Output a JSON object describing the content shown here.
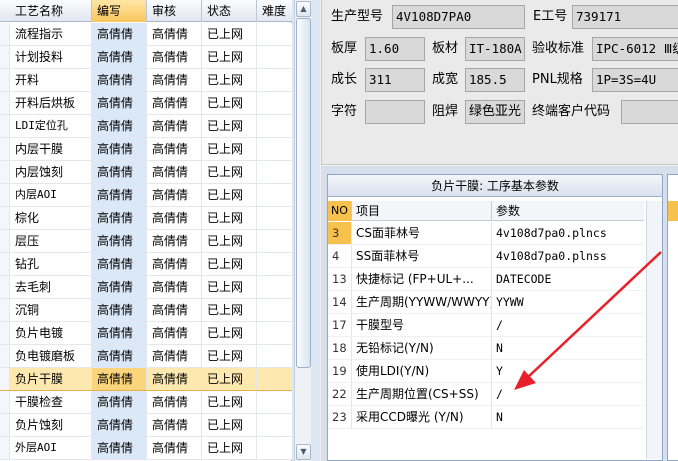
{
  "process_grid": {
    "headers": [
      "工艺名称",
      "编写",
      "审核",
      "状态",
      "难度"
    ],
    "active_header_index": 1,
    "selected_row_index": 16,
    "rows": [
      {
        "name": "流程指示",
        "writer": "高倩倩",
        "reviewer": "高倩倩",
        "status": "已上网",
        "difficulty": ""
      },
      {
        "name": "计划投料",
        "writer": "高倩倩",
        "reviewer": "高倩倩",
        "status": "已上网",
        "difficulty": ""
      },
      {
        "name": "开料",
        "writer": "高倩倩",
        "reviewer": "高倩倩",
        "status": "已上网",
        "difficulty": ""
      },
      {
        "name": "开料后烘板",
        "writer": "高倩倩",
        "reviewer": "高倩倩",
        "status": "已上网",
        "difficulty": ""
      },
      {
        "name": "LDI定位孔",
        "writer": "高倩倩",
        "reviewer": "高倩倩",
        "status": "已上网",
        "difficulty": ""
      },
      {
        "name": "内层干膜",
        "writer": "高倩倩",
        "reviewer": "高倩倩",
        "status": "已上网",
        "difficulty": ""
      },
      {
        "name": "内层蚀刻",
        "writer": "高倩倩",
        "reviewer": "高倩倩",
        "status": "已上网",
        "difficulty": ""
      },
      {
        "name": "内层AOI",
        "writer": "高倩倩",
        "reviewer": "高倩倩",
        "status": "已上网",
        "difficulty": ""
      },
      {
        "name": "棕化",
        "writer": "高倩倩",
        "reviewer": "高倩倩",
        "status": "已上网",
        "difficulty": ""
      },
      {
        "name": "层压",
        "writer": "高倩倩",
        "reviewer": "高倩倩",
        "status": "已上网",
        "difficulty": ""
      },
      {
        "name": "钻孔",
        "writer": "高倩倩",
        "reviewer": "高倩倩",
        "status": "已上网",
        "difficulty": ""
      },
      {
        "name": "去毛刺",
        "writer": "高倩倩",
        "reviewer": "高倩倩",
        "status": "已上网",
        "difficulty": ""
      },
      {
        "name": "沉铜",
        "writer": "高倩倩",
        "reviewer": "高倩倩",
        "status": "已上网",
        "difficulty": ""
      },
      {
        "name": "负片电镀",
        "writer": "高倩倩",
        "reviewer": "高倩倩",
        "status": "已上网",
        "difficulty": ""
      },
      {
        "name": "负电镀磨板",
        "writer": "高倩倩",
        "reviewer": "高倩倩",
        "status": "已上网",
        "difficulty": ""
      },
      {
        "name": "负片干膜",
        "writer": "高倩倩",
        "reviewer": "高倩倩",
        "status": "已上网",
        "difficulty": ""
      },
      {
        "name": "干膜检查",
        "writer": "高倩倩",
        "reviewer": "高倩倩",
        "status": "已上网",
        "difficulty": ""
      },
      {
        "name": "负片蚀刻",
        "writer": "高倩倩",
        "reviewer": "高倩倩",
        "status": "已上网",
        "difficulty": ""
      },
      {
        "name": "外层AOI",
        "writer": "高倩倩",
        "reviewer": "高倩倩",
        "status": "已上网",
        "difficulty": ""
      }
    ]
  },
  "info": {
    "model_label": "生产型号",
    "model_value": "4V108D7PA0",
    "eno_label": "E工号",
    "eno_value": "739171",
    "thickness_label": "板厚",
    "thickness_value": "1.60",
    "material_label": "板材",
    "material_value": "IT-180A",
    "standard_label": "验收标准",
    "standard_value": "IPC-6012 Ⅲ级",
    "length_label": "成长",
    "length_value": "311",
    "width_label": "成宽",
    "width_value": "185.5",
    "pnl_label": "PNL规格",
    "pnl_value": "1P=3S=4U",
    "char_label": "字符",
    "char_value": "",
    "mask_label": "阻焊",
    "mask_value": "绿色亚光",
    "customer_label": "终端客户代码",
    "customer_value": ""
  },
  "param_panel": {
    "title": "负片干膜: 工序基本参数",
    "headers": {
      "no": "NO",
      "item": "项目",
      "value": "参数"
    },
    "selected_row_index": 0,
    "rows": [
      {
        "no": "3",
        "item": "CS面菲林号",
        "value": "4v108d7pa0.plncs"
      },
      {
        "no": "4",
        "item": "SS面菲林号",
        "value": "4v108d7pa0.plnss"
      },
      {
        "no": "13",
        "item": "快捷标记 (FP+UL+...",
        "value": "DATECODE"
      },
      {
        "no": "14",
        "item": "生产周期(YYWW/WWYY)",
        "value": "YYWW"
      },
      {
        "no": "17",
        "item": "干膜型号",
        "value": "/"
      },
      {
        "no": "18",
        "item": "无铅标记(Y/N)",
        "value": "N"
      },
      {
        "no": "19",
        "item": "使用LDI(Y/N)",
        "value": "Y"
      },
      {
        "no": "22",
        "item": "生产周期位置(CS+SS)",
        "value": "/"
      },
      {
        "no": "23",
        "item": "采用CCD曝光 (Y/N)",
        "value": "N"
      }
    ]
  },
  "colors": {
    "selection": "#fde9b0",
    "header_accent": "#f7c14d",
    "annotation_arrow": "#e8202a"
  }
}
